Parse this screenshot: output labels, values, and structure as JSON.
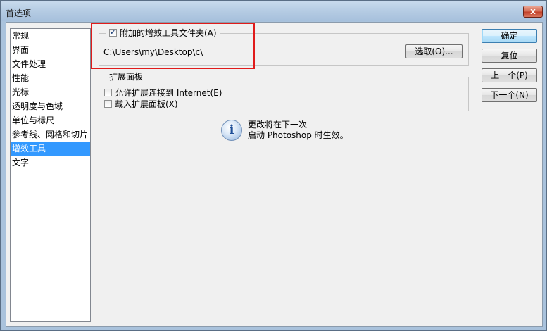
{
  "window": {
    "title": "首选项",
    "close_glyph": "x"
  },
  "sidebar": {
    "items": [
      {
        "label": "常规",
        "selected": false
      },
      {
        "label": "界面",
        "selected": false
      },
      {
        "label": "文件处理",
        "selected": false
      },
      {
        "label": "性能",
        "selected": false
      },
      {
        "label": "光标",
        "selected": false
      },
      {
        "label": "透明度与色域",
        "selected": false
      },
      {
        "label": "单位与标尺",
        "selected": false
      },
      {
        "label": "参考线、网格和切片",
        "selected": false
      },
      {
        "label": "增效工具",
        "selected": true
      },
      {
        "label": "文字",
        "selected": false
      }
    ]
  },
  "plugins_folder": {
    "checkbox_label": "附加的增效工具文件夹(A)",
    "checked": true,
    "path": "C:\\Users\\my\\Desktop\\c\\",
    "choose_label": "选取(O)..."
  },
  "extension_panels": {
    "legend": "扩展面板",
    "allow_internet_label": "允许扩展连接到 Internet(E)",
    "allow_internet_checked": false,
    "load_panels_label": "载入扩展面板(X)",
    "load_panels_checked": false
  },
  "notice": {
    "icon": "info-icon",
    "line1": "更改将在下一次",
    "line2": "启动 Photoshop 时生效。"
  },
  "buttons": {
    "ok": "确定",
    "reset": "复位",
    "prev": "上一个(P)",
    "next": "下一个(N)"
  }
}
